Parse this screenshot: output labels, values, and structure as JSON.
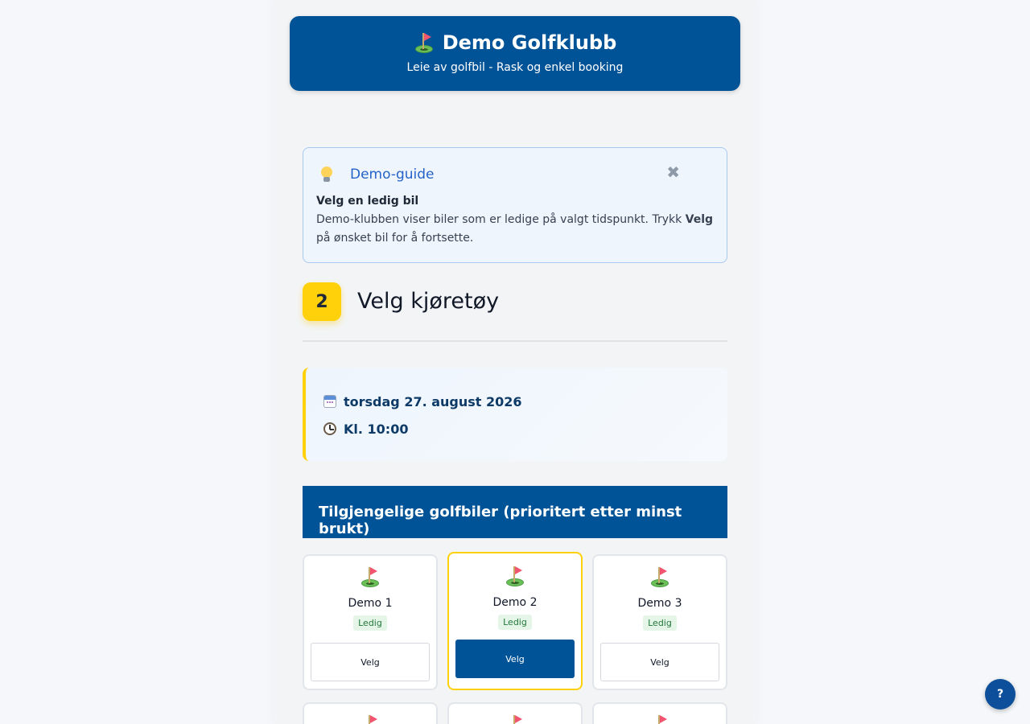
{
  "header": {
    "title": "Demo Golfklubb",
    "subtitle": "Leie av golfbil - Rask og enkel booking",
    "icon": "golf-flag-icon"
  },
  "guide": {
    "title": "Demo-guide",
    "icon": "lightbulb-icon",
    "close_symbol": "✖",
    "heading": "Velg en ledig bil",
    "text_before": "Demo-klubben viser biler som er ledige på valgt tidspunkt. Trykk ",
    "text_bold": "Velg",
    "text_after": " på ønsket bil for å fortsette."
  },
  "step": {
    "number": "2",
    "title": "Velg kjøretøy"
  },
  "booking": {
    "date": "torsdag 27. august 2026",
    "time": "Kl. 10:00"
  },
  "available": {
    "heading": "Tilgjengelige golfbiler (prioritert etter minst brukt)",
    "cars": [
      {
        "name": "Demo 1",
        "status": "Ledig",
        "button": "Velg",
        "selected": false
      },
      {
        "name": "Demo 2",
        "status": "Ledig",
        "button": "Velg",
        "selected": true
      },
      {
        "name": "Demo 3",
        "status": "Ledig",
        "button": "Velg",
        "selected": false
      }
    ]
  },
  "help_button": "?",
  "colors": {
    "primary": "#005396",
    "accent": "#ffd10a",
    "status_green": "#22783c",
    "guide_title": "#2563c9"
  }
}
